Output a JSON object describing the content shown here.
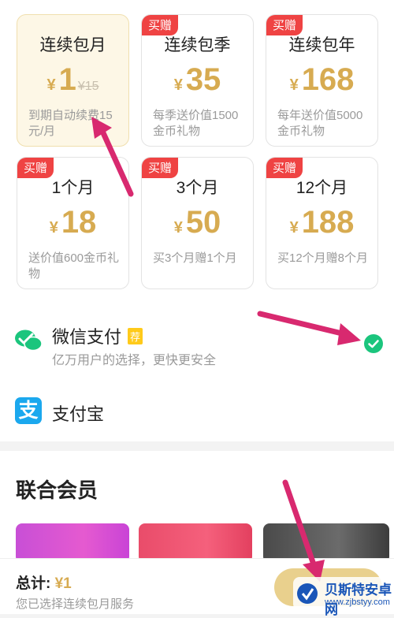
{
  "plans": [
    {
      "name": "连续包月",
      "badge": "",
      "yen": "¥",
      "price": "1",
      "old_price": "¥15",
      "desc": "到期自动续费15元/月"
    },
    {
      "name": "连续包季",
      "badge": "买赠",
      "yen": "¥",
      "price": "35",
      "old_price": "",
      "desc": "每季送价值1500金币礼物"
    },
    {
      "name": "连续包年",
      "badge": "买赠",
      "yen": "¥",
      "price": "168",
      "old_price": "",
      "desc": "每年送价值5000金币礼物"
    },
    {
      "name": "1个月",
      "badge": "买赠",
      "yen": "¥",
      "price": "18",
      "old_price": "",
      "desc": "送价值600金币礼物"
    },
    {
      "name": "3个月",
      "badge": "买赠",
      "yen": "¥",
      "price": "50",
      "old_price": "",
      "desc": "买3个月赠1个月"
    },
    {
      "name": "12个月",
      "badge": "买赠",
      "yen": "¥",
      "price": "188",
      "old_price": "",
      "desc": "买12个月赠8个月"
    }
  ],
  "payment": {
    "wechat": {
      "title": "微信支付",
      "tag": "荐",
      "subtitle": "亿万用户的选择，更快更安全"
    },
    "alipay": {
      "title": "支付宝"
    }
  },
  "joint": {
    "title": "联合会员"
  },
  "footer": {
    "total_label": "总计: ",
    "total_value": "¥1",
    "subtitle": "您已选择连续包月服务"
  },
  "watermark": {
    "line1": "贝斯特安卓网",
    "line2": "www.zjbstyy.com"
  },
  "colors": {
    "accent": "#d7ab51",
    "badge": "#ef4343",
    "check": "#1bc57d",
    "alipay": "#1ba8ee",
    "arrow": "#d8296f"
  }
}
